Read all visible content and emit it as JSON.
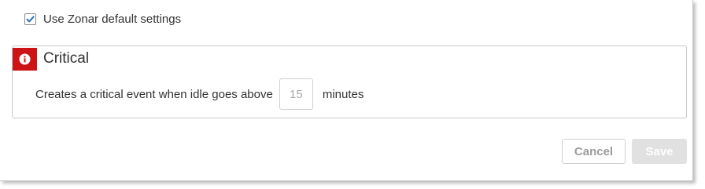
{
  "defaults": {
    "checked": true,
    "label": "Use Zonar default settings"
  },
  "alert": {
    "severity_icon": "info-icon",
    "severity_color": "#cc1417",
    "title": "Critical",
    "description": "Creates a critical event when idle goes above",
    "threshold_value": "15",
    "unit": "minutes"
  },
  "actions": {
    "cancel_label": "Cancel",
    "save_label": "Save"
  },
  "colors": {
    "checkbox_check": "#2a6fbf",
    "text": "#333333",
    "disabled_button": "#e1e1e1"
  }
}
